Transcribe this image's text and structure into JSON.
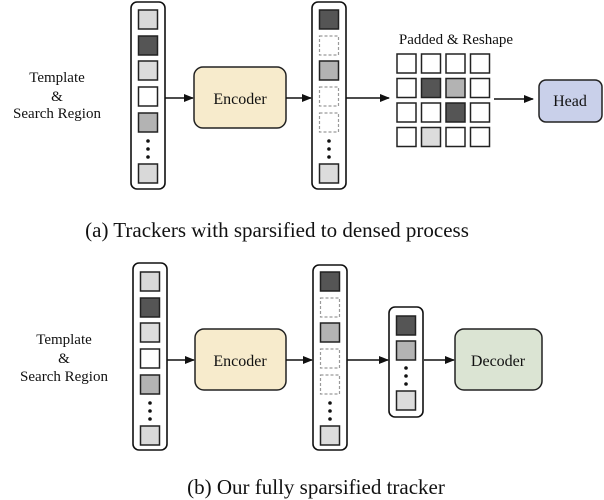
{
  "colors": {
    "encoder_fill": "#f7ebcc",
    "head_fill": "#c9d0ea",
    "decoder_fill": "#dbe4d3",
    "token_shades": {
      "light": "#d9d9d9",
      "dark": "#555555",
      "pale": "#dcdcdc",
      "white": "#ffffff",
      "mid": "#b3b3b3",
      "empty": "none"
    }
  },
  "panel_a": {
    "input_label_line1": "Template",
    "input_label_line2": "&",
    "input_label_line3": "Search Region",
    "input_tokens": [
      "light",
      "dark",
      "pale",
      "white",
      "mid",
      "dots",
      "light"
    ],
    "encoder_label": "Encoder",
    "sparse_tokens": [
      "dark",
      "empty",
      "mid",
      "empty",
      "empty",
      "dots",
      "pale"
    ],
    "reshape_label": "Padded & Reshape",
    "grid": [
      [
        "white",
        "white",
        "white",
        "white"
      ],
      [
        "white",
        "dark",
        "mid",
        "white"
      ],
      [
        "white",
        "white",
        "dark",
        "white"
      ],
      [
        "white",
        "pale",
        "white",
        "white"
      ]
    ],
    "head_label": "Head",
    "caption": "(a) Trackers with sparsified to densed process"
  },
  "panel_b": {
    "input_label_line1": "Template",
    "input_label_line2": "&",
    "input_label_line3": "Search Region",
    "input_tokens": [
      "light",
      "dark",
      "pale",
      "white",
      "mid",
      "dots",
      "light"
    ],
    "encoder_label": "Encoder",
    "sparse_tokens": [
      "dark",
      "empty",
      "mid",
      "empty",
      "empty",
      "dots",
      "pale"
    ],
    "compact_tokens": [
      "dark",
      "mid",
      "dots",
      "pale"
    ],
    "decoder_label": "Decoder",
    "caption": "(b) Our fully sparsified tracker"
  }
}
